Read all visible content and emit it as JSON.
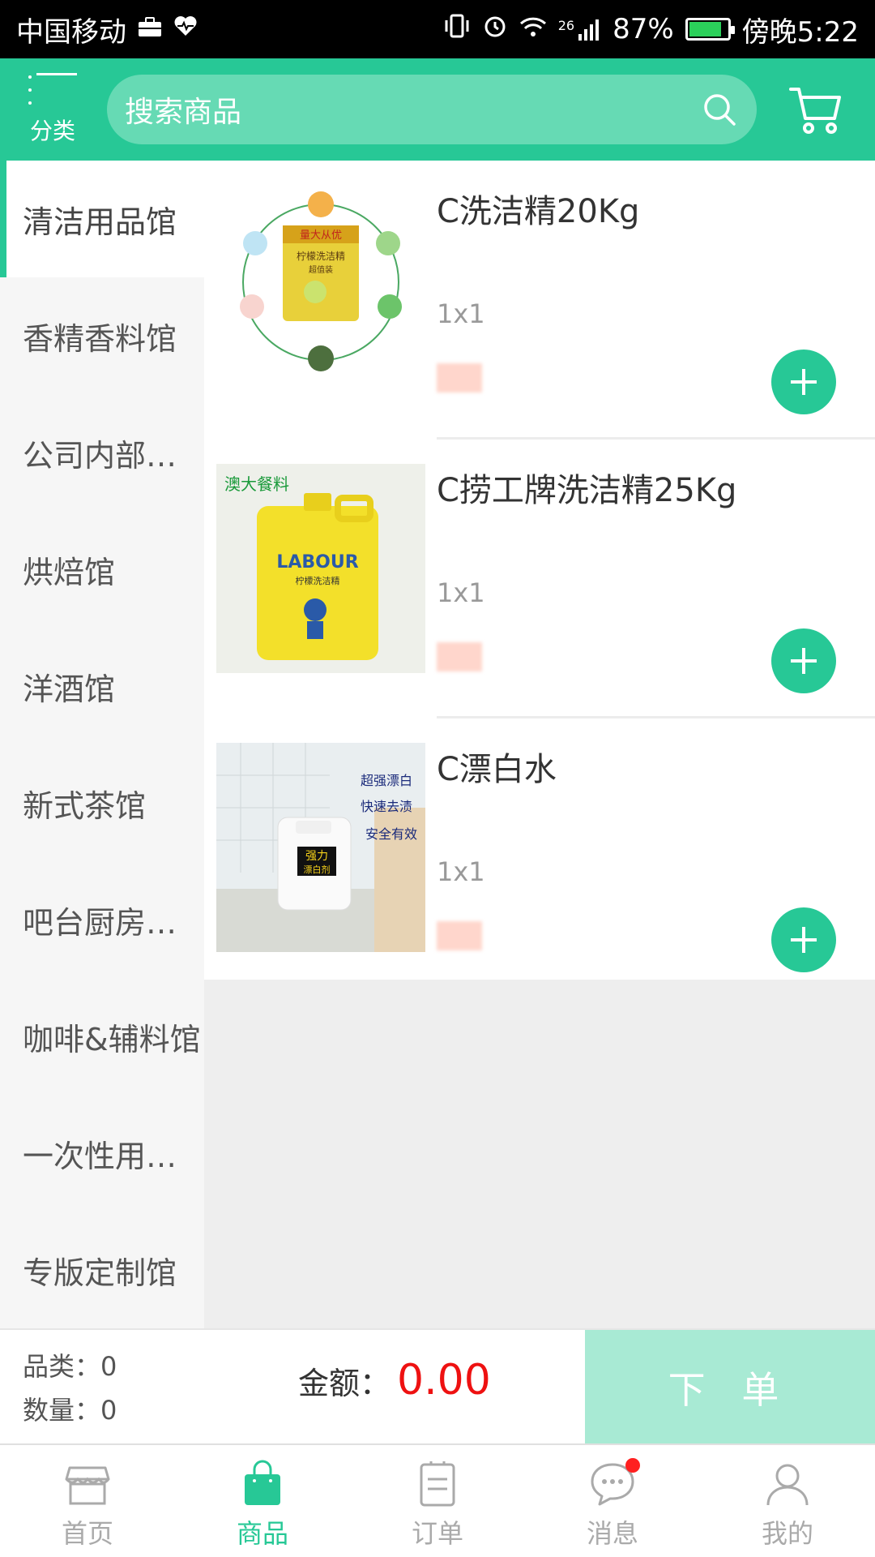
{
  "status_bar": {
    "carrier": "中国移动",
    "battery": "87%",
    "time": "傍晚5:22",
    "network": "26",
    "battery_level": 0.87
  },
  "header": {
    "category_label": "分类",
    "search_placeholder": "搜索商品",
    "icons": [
      "menu-icon",
      "search-icon",
      "cart-icon"
    ]
  },
  "sidebar": {
    "items": [
      {
        "label": "清洁用品馆"
      },
      {
        "label": "香精香料馆"
      },
      {
        "label": "公司内部自..."
      },
      {
        "label": "烘焙馆"
      },
      {
        "label": "洋酒馆"
      },
      {
        "label": "新式茶馆"
      },
      {
        "label": "吧台厨房设..."
      },
      {
        "label": "咖啡&辅料馆"
      },
      {
        "label": "一次性用品..."
      },
      {
        "label": "专版定制馆"
      }
    ],
    "active_index": 0
  },
  "products": [
    {
      "name": "C洗洁精20Kg",
      "spec": "1x1",
      "image_text": [
        "量大从优",
        "柠檬洗洁精",
        "超值装"
      ]
    },
    {
      "name": "C捞工牌洗洁精25Kg",
      "spec": "1x1",
      "image_text": [
        "澳大餐料",
        "LABOUR",
        "柠檬洗洁精"
      ]
    },
    {
      "name": "C漂白水",
      "spec": "1x1",
      "image_text": [
        "超强漂白",
        "快速去渍",
        "安全有效",
        "强力",
        "漂白剂"
      ]
    }
  ],
  "checkout": {
    "category_count": "品类：0",
    "quantity": "数量：0",
    "amount_label": "金额：",
    "amount_value": "0.00",
    "order_button": "下 单"
  },
  "tabbar": {
    "tabs": [
      {
        "label": "首页",
        "icon": "store-icon"
      },
      {
        "label": "商品",
        "icon": "bag-icon"
      },
      {
        "label": "订单",
        "icon": "order-icon"
      },
      {
        "label": "消息",
        "icon": "message-icon"
      },
      {
        "label": "我的",
        "icon": "user-icon"
      }
    ],
    "active_index": 1
  },
  "colors": {
    "brand": "#27c896",
    "search_bg": "#66dab4",
    "order_button_bg": "#a8ead4",
    "amount": "#ee1111"
  }
}
